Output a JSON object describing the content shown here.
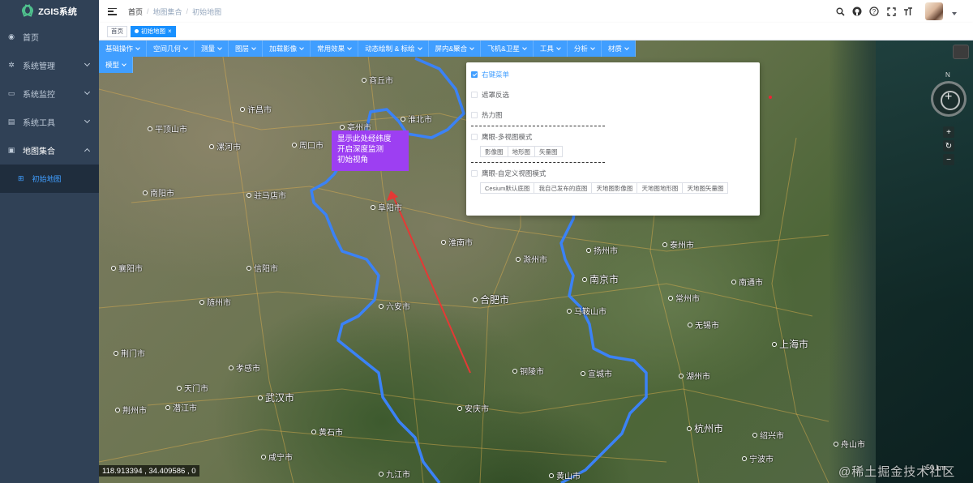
{
  "app": {
    "logo_text": "ZGIS系统"
  },
  "sidebar": {
    "items": [
      {
        "label": "首页",
        "icon": "dashboard-icon"
      },
      {
        "label": "系统管理",
        "icon": "gear-icon"
      },
      {
        "label": "系统监控",
        "icon": "monitor-icon"
      },
      {
        "label": "系统工具",
        "icon": "tool-icon"
      },
      {
        "label": "地图集合",
        "icon": "map-icon"
      }
    ],
    "active_sub": "初始地图"
  },
  "header": {
    "breadcrumb": [
      "首页",
      "地图集合",
      "初始地图"
    ],
    "separator": "/"
  },
  "tags": {
    "home": "首页",
    "active": "初始地图"
  },
  "map_menu": {
    "row1": [
      "基础操作",
      "空间几何",
      "测量",
      "图层",
      "加载影像",
      "常用效果",
      "动态绘制 & 标绘",
      "屏内&聚合",
      "飞机&卫星",
      "工具",
      "分析",
      "材质"
    ],
    "row2": [
      "模型"
    ]
  },
  "annotation": {
    "lines": [
      "显示此处经纬度",
      "开启深度监测",
      "初始视角"
    ]
  },
  "panel": {
    "right_menu": "右键菜单",
    "mask": "遮罩反选",
    "heatmap": "热力图",
    "eagle_multi": "鹰眼-多视图模式",
    "multi_buttons": [
      "影像图",
      "地形图",
      "矢量图"
    ],
    "eagle_custom": "鹰眼-自定义视图模式",
    "custom_buttons": [
      "Cesium默认底图",
      "我自己发布的底图",
      "天地图影像图",
      "天地图地形图",
      "天地图矢量图"
    ]
  },
  "cities": [
    {
      "name": "商丘市"
    },
    {
      "name": "许昌市"
    },
    {
      "name": "淮北市"
    },
    {
      "name": "平顶山市"
    },
    {
      "name": "漯河市"
    },
    {
      "name": "周口市"
    },
    {
      "name": "亳州市"
    },
    {
      "name": "南阳市"
    },
    {
      "name": "驻马店市"
    },
    {
      "name": "阜阳市"
    },
    {
      "name": "淮南市"
    },
    {
      "name": "扬州市"
    },
    {
      "name": "泰州市"
    },
    {
      "name": "滁州市"
    },
    {
      "name": "襄阳市"
    },
    {
      "name": "信阳市"
    },
    {
      "name": "南京市"
    },
    {
      "name": "南通市"
    },
    {
      "name": "合肥市"
    },
    {
      "name": "常州市"
    },
    {
      "name": "随州市"
    },
    {
      "name": "六安市"
    },
    {
      "name": "马鞍山市"
    },
    {
      "name": "无锡市"
    },
    {
      "name": "荆门市"
    },
    {
      "name": "上海市"
    },
    {
      "name": "孝感市"
    },
    {
      "name": "铜陵市"
    },
    {
      "name": "宣城市"
    },
    {
      "name": "湖州市"
    },
    {
      "name": "天门市"
    },
    {
      "name": "武汉市"
    },
    {
      "name": "潜江市"
    },
    {
      "name": "荆州市"
    },
    {
      "name": "安庆市"
    },
    {
      "name": "黄石市"
    },
    {
      "name": "杭州市"
    },
    {
      "name": "咸宁市"
    },
    {
      "name": "绍兴市"
    },
    {
      "name": "舟山市"
    },
    {
      "name": "九江市"
    },
    {
      "name": "黄山市"
    },
    {
      "name": "宁波市"
    }
  ],
  "status": {
    "coords": "118.913394 ,  34.409586 ,  0",
    "scale": "50 km"
  },
  "compass_north": "N",
  "watermark": "@稀土掘金技术社区",
  "colors": {
    "sidebar": "#304156",
    "accent": "#409eff",
    "annotation": "#9d3ff2",
    "boundary": "#3b82f6",
    "arrow": "#e53935"
  }
}
